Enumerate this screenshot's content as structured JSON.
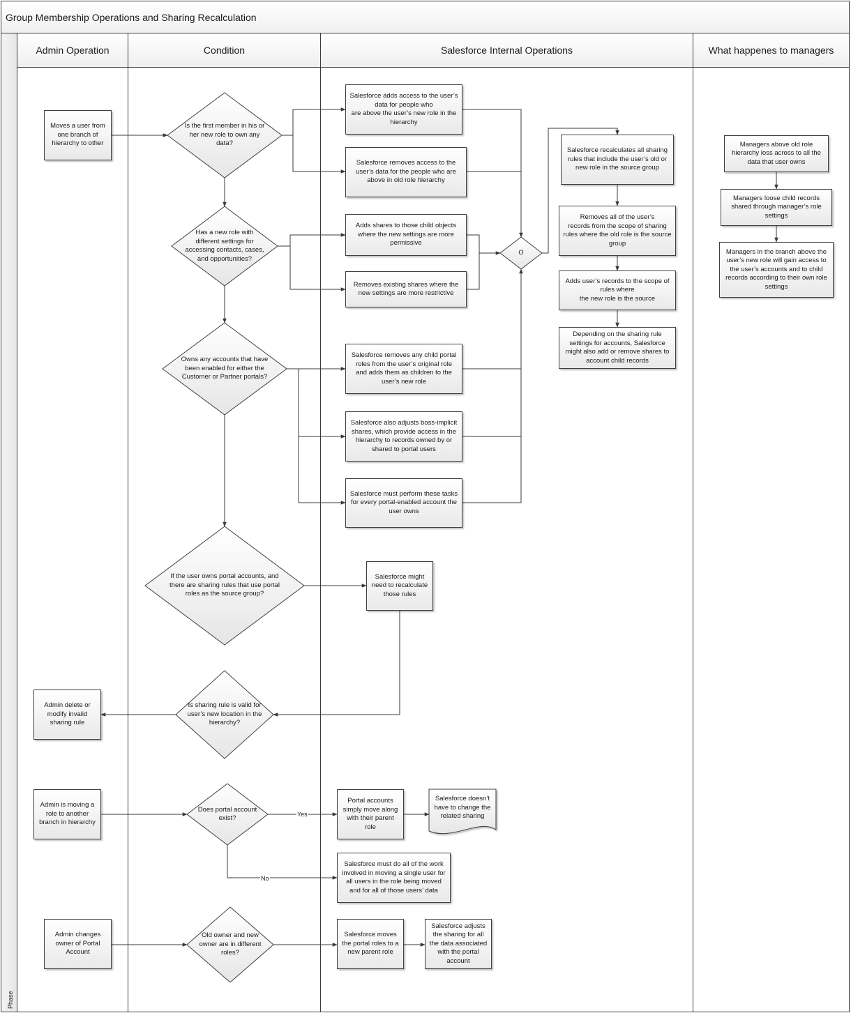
{
  "title": "Group Membership Operations and Sharing Recalculation",
  "phase_label": "Phase",
  "lanes": [
    {
      "id": "admin",
      "label": "Admin Operation"
    },
    {
      "id": "condition",
      "label": "Condition"
    },
    {
      "id": "internal",
      "label": "Salesforce Internal Operations"
    },
    {
      "id": "managers",
      "label": "What happenes to managers"
    }
  ],
  "nodes": {
    "move_user": {
      "type": "process",
      "lane": "admin",
      "text": "Moves a user from\none branch of\nhierarchy to other"
    },
    "q_first_member": {
      "type": "decision",
      "lane": "condition",
      "text": "Is the first member in his or\nher new role to own any\ndata?"
    },
    "add_access_new": {
      "type": "process",
      "lane": "internal",
      "text": "Salesforce adds access to the user’s\ndata for people who\nare above the user’s new role in the\nhierarchy"
    },
    "remove_access_old": {
      "type": "process",
      "lane": "internal",
      "text": "Salesforce removes access to the\nuser’s data for the people who are\nabove in old role hierarchy"
    },
    "q_new_role_settings": {
      "type": "decision",
      "lane": "condition",
      "text": "Has a new role with\ndifferent settings for\naccessing contacts, cases,\nand opportunities?"
    },
    "add_shares_child": {
      "type": "process",
      "lane": "internal",
      "text": "Adds shares to those child objects\nwhere the new settings are more\npermissive"
    },
    "remove_shares_restrictive": {
      "type": "process",
      "lane": "internal",
      "text": "Removes existing shares where the\nnew settings are more restrictive"
    },
    "merge_or": {
      "type": "decision",
      "lane": "internal",
      "text": "O"
    },
    "recalc_sharing_rules": {
      "type": "process",
      "lane": "internal",
      "text": "Salesforce recalculates all sharing\nrules that include the user’s old or\nnew role in the source group"
    },
    "remove_records_scope": {
      "type": "process",
      "lane": "internal",
      "text": "Removes all of the user’s\nrecords from the scope of sharing\nrules where the old role is the source\ngroup"
    },
    "add_records_scope": {
      "type": "process",
      "lane": "internal",
      "text": "Adds user’s records to the scope of\nrules where\nthe new role is the source"
    },
    "account_child_shares": {
      "type": "process",
      "lane": "internal",
      "text": "Depending on the sharing rule\nsettings for accounts, Salesforce\nmight also add or remove shares to\naccount child records"
    },
    "q_owns_portal_accounts": {
      "type": "decision",
      "lane": "condition",
      "text": "Owns any accounts that have\nbeen enabled for either the\nCustomer or Partner portals?"
    },
    "remove_child_portal_roles": {
      "type": "process",
      "lane": "internal",
      "text": "Salesforce removes any child portal\nroles from the user’s original role\nand adds them as children to the\nuser’s new role"
    },
    "adjust_boss_implicit": {
      "type": "process",
      "lane": "internal",
      "text": "Salesforce also adjusts boss-implicit\nshares, which provide access in the\nhierarchy to records owned by or\nshared to portal users"
    },
    "perform_every_account": {
      "type": "process",
      "lane": "internal",
      "text": "Salesforce must perform these tasks\nfor every portal-enabled account the\nuser owns"
    },
    "q_portal_sharing_rules": {
      "type": "decision",
      "lane": "condition",
      "text": "If the user owns portal accounts, and\nthere are sharing rules that use portal\nroles as the source group?"
    },
    "might_recalc_rules": {
      "type": "process",
      "lane": "internal",
      "text": "Salesforce might\nneed to recalculate\nthose rules"
    },
    "q_rule_valid": {
      "type": "decision",
      "lane": "condition",
      "text": "Is sharing rule is valid for\nuser’s new location in the\nhierarchy?"
    },
    "admin_fix_rule": {
      "type": "process",
      "lane": "admin",
      "text": "Admin delete or\nmodify invalid\nsharing rule"
    },
    "mgr_lose_access": {
      "type": "process",
      "lane": "managers",
      "text": "Managers above old role\nhierarchy loss across to all the\ndata that user owns"
    },
    "mgr_lose_child": {
      "type": "process",
      "lane": "managers",
      "text": "Managers loose child records\nshared through manager’s role\nsettings"
    },
    "mgr_gain_access": {
      "type": "process",
      "lane": "managers",
      "text": "Managers in the branch above the\nuser’s new role will gain access to\nthe user’s accounts and to child\nrecords according to their own role\nsettings"
    },
    "admin_move_role": {
      "type": "process",
      "lane": "admin",
      "text": "Admin is moving a\nrole to another\nbranch in hierarchy"
    },
    "q_portal_exists": {
      "type": "decision",
      "lane": "condition",
      "text": "Does portal account\nexist?"
    },
    "portal_move_along": {
      "type": "process",
      "lane": "internal",
      "text": "Portal accounts\nsimply move along\nwith their parent\nrole"
    },
    "no_change_sharing": {
      "type": "document",
      "lane": "internal",
      "text": "Salesforce doesn’t\nhave to change the\nrelated sharing"
    },
    "do_all_work": {
      "type": "process",
      "lane": "internal",
      "text": "Salesforce must do all of the work\ninvolved in moving a single user for\nall users in the role being moved\nand for all of those users’ data"
    },
    "admin_change_owner": {
      "type": "process",
      "lane": "admin",
      "text": "Admin changes\nowner of Portal\nAccount"
    },
    "q_different_roles": {
      "type": "decision",
      "lane": "condition",
      "text": "Old owner and new\nowner are in different\nroles?"
    },
    "move_portal_roles": {
      "type": "process",
      "lane": "internal",
      "text": "Salesforce moves\nthe portal roles to a\nnew parent role"
    },
    "adjust_sharing_portal": {
      "type": "process",
      "lane": "internal",
      "text": "Salesforce adjusts\nthe sharing for all\nthe data associated\nwith the portal\naccount"
    }
  },
  "edge_labels": {
    "yes": "Yes",
    "no": "No"
  },
  "colors": {
    "line": "#3a3a3a",
    "fill_top": "#ffffff",
    "fill_bottom": "#e8e8e8"
  }
}
